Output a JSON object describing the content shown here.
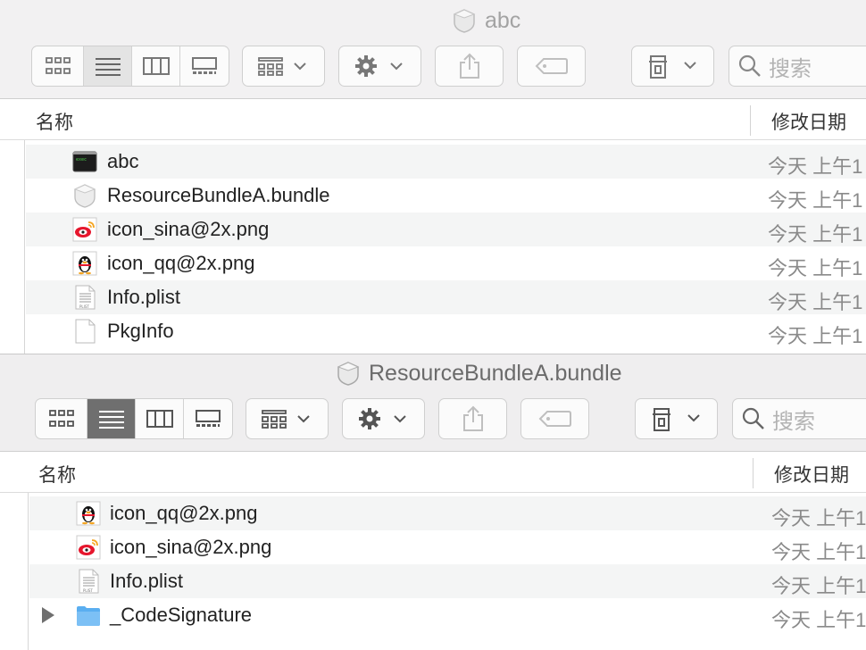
{
  "window1": {
    "title": "abc",
    "search_placeholder": "搜索",
    "columns": {
      "name": "名称",
      "date": "修改日期"
    },
    "files": [
      {
        "name": "abc",
        "icon": "terminal-exec-icon",
        "date": "今天 上午1"
      },
      {
        "name": "ResourceBundleA.bundle",
        "icon": "bundle-icon",
        "date": "今天 上午1"
      },
      {
        "name": "icon_sina@2x.png",
        "icon": "weibo-icon",
        "date": "今天 上午1"
      },
      {
        "name": "icon_qq@2x.png",
        "icon": "qq-penguin-icon",
        "date": "今天 上午1"
      },
      {
        "name": "Info.plist",
        "icon": "plist-file-icon",
        "date": "今天 上午1"
      },
      {
        "name": "PkgInfo",
        "icon": "blank-file-icon",
        "date": "今天 上午1"
      }
    ]
  },
  "window2": {
    "title": "ResourceBundleA.bundle",
    "search_placeholder": "搜索",
    "columns": {
      "name": "名称",
      "date": "修改日期"
    },
    "files": [
      {
        "name": "icon_qq@2x.png",
        "icon": "qq-penguin-icon",
        "date": "今天 上午1"
      },
      {
        "name": "icon_sina@2x.png",
        "icon": "weibo-icon",
        "date": "今天 上午1"
      },
      {
        "name": "Info.plist",
        "icon": "plist-file-icon",
        "date": "今天 上午1"
      },
      {
        "name": "_CodeSignature",
        "icon": "folder-icon",
        "date": "今天 上午1"
      }
    ]
  },
  "colors": {
    "folder": "#5aaef0",
    "active_view_dark": "#6f6f6f",
    "active_view_light": "#e4e4e4"
  }
}
